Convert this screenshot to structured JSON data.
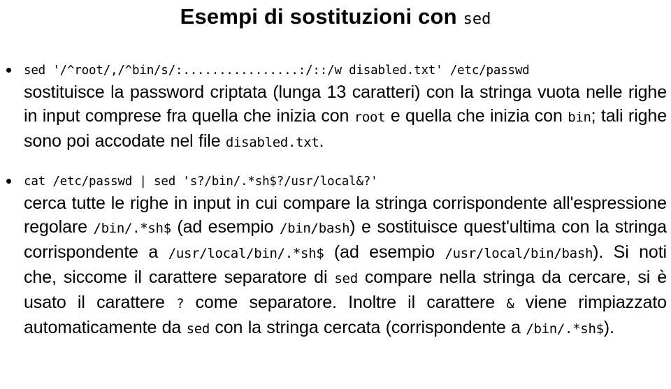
{
  "slide": {
    "title_text": "Esempi di sostituzioni con",
    "title_mono": "sed",
    "bullets": [
      {
        "code": "sed '/^root/,/^bin/s/:................:/::/w disabled.txt' /etc/passwd",
        "description_parts": [
          {
            "type": "text",
            "value": "sostituisce la password criptata (lunga 13 caratteri) con la stringa vuota nelle righe in input comprese fra quella che inizia con "
          },
          {
            "type": "mono",
            "value": "root"
          },
          {
            "type": "text",
            "value": " e quella che inizia con "
          },
          {
            "type": "mono",
            "value": "bin"
          },
          {
            "type": "text",
            "value": "; tali righe sono poi accodate nel file "
          },
          {
            "type": "mono",
            "value": "disabled.txt"
          },
          {
            "type": "text",
            "value": "."
          }
        ]
      },
      {
        "code": "cat /etc/passwd | sed 's?/bin/.*sh$?/usr/local&?'",
        "description_parts": [
          {
            "type": "text",
            "value": "cerca tutte le righe in input in cui compare la stringa corrispondente all'espressione regolare "
          },
          {
            "type": "mono",
            "value": "/bin/.*sh$"
          },
          {
            "type": "text",
            "value": " (ad esempio "
          },
          {
            "type": "mono",
            "value": "/bin/bash"
          },
          {
            "type": "text",
            "value": ") e sostituisce quest'ultima con la stringa corrispondente a "
          },
          {
            "type": "mono",
            "value": "/usr/local/bin/.*sh$"
          },
          {
            "type": "text",
            "value": " (ad esempio "
          },
          {
            "type": "mono",
            "value": "/usr/local/bin/bash"
          },
          {
            "type": "text",
            "value": ").  Si noti che, siccome il carattere separatore di "
          },
          {
            "type": "mono",
            "value": "sed"
          },
          {
            "type": "text",
            "value": " compare nella stringa da cercare, si è usato il carattere "
          },
          {
            "type": "mono",
            "value": "?"
          },
          {
            "type": "text",
            "value": " come separatore.  Inoltre il carattere "
          },
          {
            "type": "mono",
            "value": "&"
          },
          {
            "type": "text",
            "value": " viene rimpiazzato automaticamente da "
          },
          {
            "type": "mono",
            "value": "sed"
          },
          {
            "type": "text",
            "value": " con la stringa cercata (corrispondente a "
          },
          {
            "type": "mono",
            "value": "/bin/.*sh$"
          },
          {
            "type": "text",
            "value": ")."
          }
        ]
      }
    ],
    "bullet_marker": "bullet-dot",
    "colors": {
      "background": "#ffffff",
      "text": "#000000"
    }
  }
}
